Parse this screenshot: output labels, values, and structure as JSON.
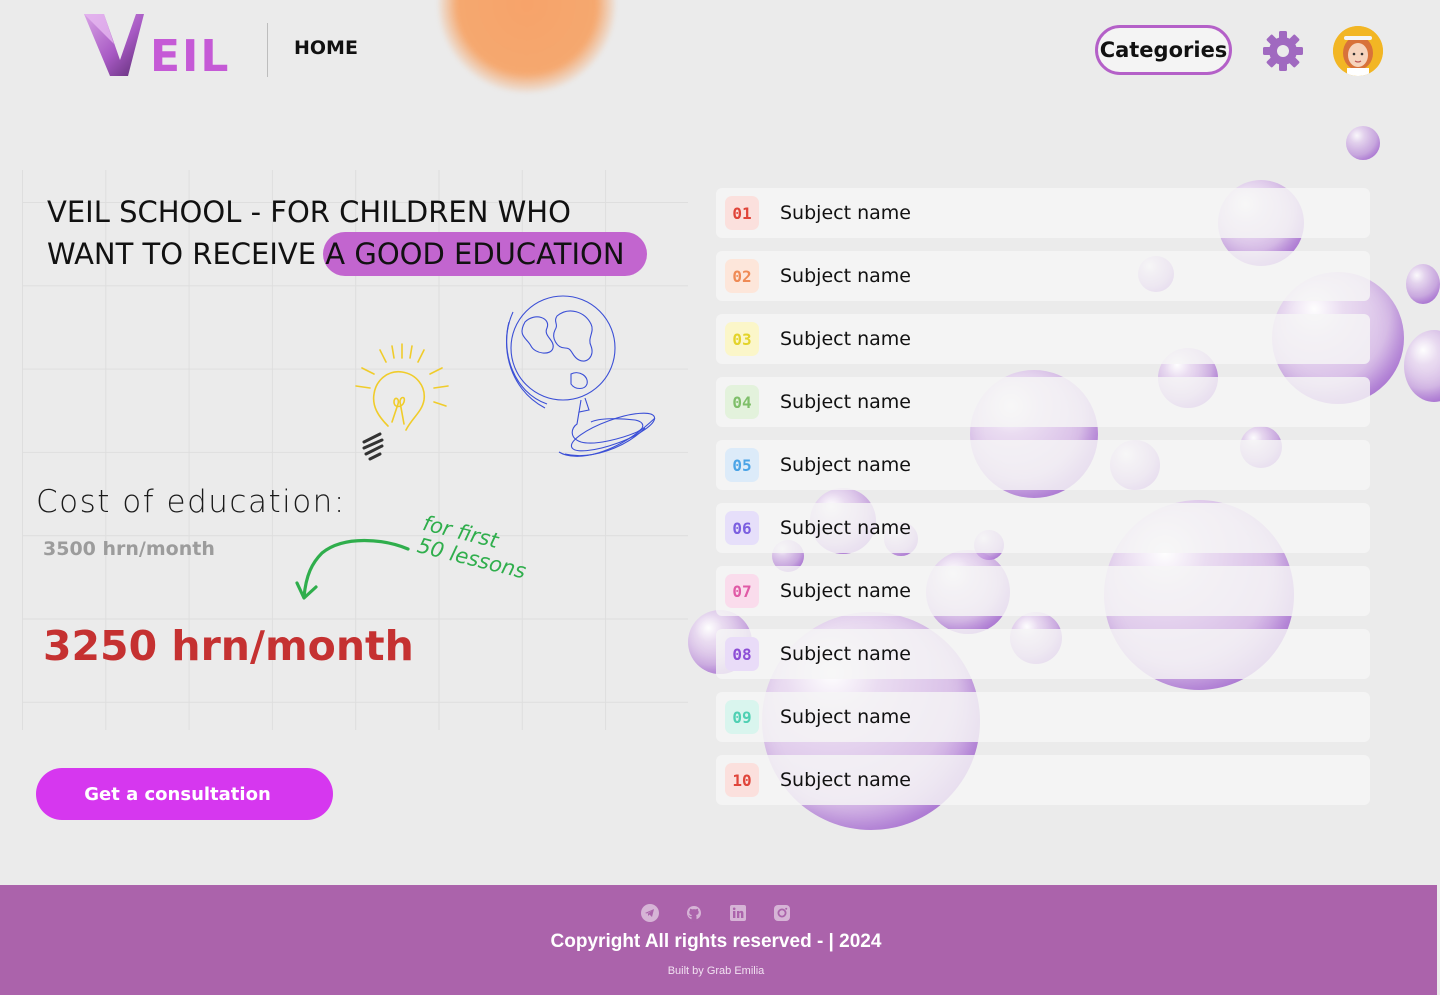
{
  "header": {
    "logo_text": "EIL",
    "nav_home": "HOME",
    "categories_label": "Categories",
    "settings_icon": "gear-icon",
    "avatar_icon": "user-avatar"
  },
  "hero": {
    "title_line1": "VEIL SCHOOL - FOR CHILDREN WHO",
    "title_line2_plain": "WANT TO RECEIVE ",
    "title_line2_highlight": "A GOOD EDUCATION",
    "highlight_color": "#c265cf"
  },
  "pricing": {
    "cost_label": "Cost of education:",
    "old_price": "3500 hrn/month",
    "promo_note_line1": "for first",
    "promo_note_line2": "50 lessons",
    "new_price": "3250 hrn/month",
    "new_price_color": "#c53131"
  },
  "cta": {
    "consult_label": "Get a consultation",
    "color": "#d637ef"
  },
  "subjects": [
    {
      "num": "01",
      "name": "Subject name",
      "color": "#e0453a",
      "bg": "#fbe0dd"
    },
    {
      "num": "02",
      "name": "Subject name",
      "color": "#ef8a55",
      "bg": "#fde6da"
    },
    {
      "num": "03",
      "name": "Subject name",
      "color": "#e3d32a",
      "bg": "#fbf6c9"
    },
    {
      "num": "04",
      "name": "Subject name",
      "color": "#7fbf6a",
      "bg": "#e3f2dc"
    },
    {
      "num": "05",
      "name": "Subject name",
      "color": "#4aa3e6",
      "bg": "#dcebf9"
    },
    {
      "num": "06",
      "name": "Subject name",
      "color": "#7b5fe0",
      "bg": "#e6dffa"
    },
    {
      "num": "07",
      "name": "Subject name",
      "color": "#e05aa6",
      "bg": "#fadcec"
    },
    {
      "num": "08",
      "name": "Subject name",
      "color": "#8d4ed6",
      "bg": "#e9dcf8"
    },
    {
      "num": "09",
      "name": "Subject name",
      "color": "#4fd0b3",
      "bg": "#d9f5ee"
    },
    {
      "num": "10",
      "name": "Subject name",
      "color": "#e0453a",
      "bg": "#fbe0dd"
    }
  ],
  "footer": {
    "icons": [
      "telegram-icon",
      "github-icon",
      "linkedin-icon",
      "instagram-icon"
    ],
    "copyright": "Copyright All rights reserved - | 2024",
    "built_by": "Built by Grab Emilia",
    "background": "#ab63ab"
  }
}
